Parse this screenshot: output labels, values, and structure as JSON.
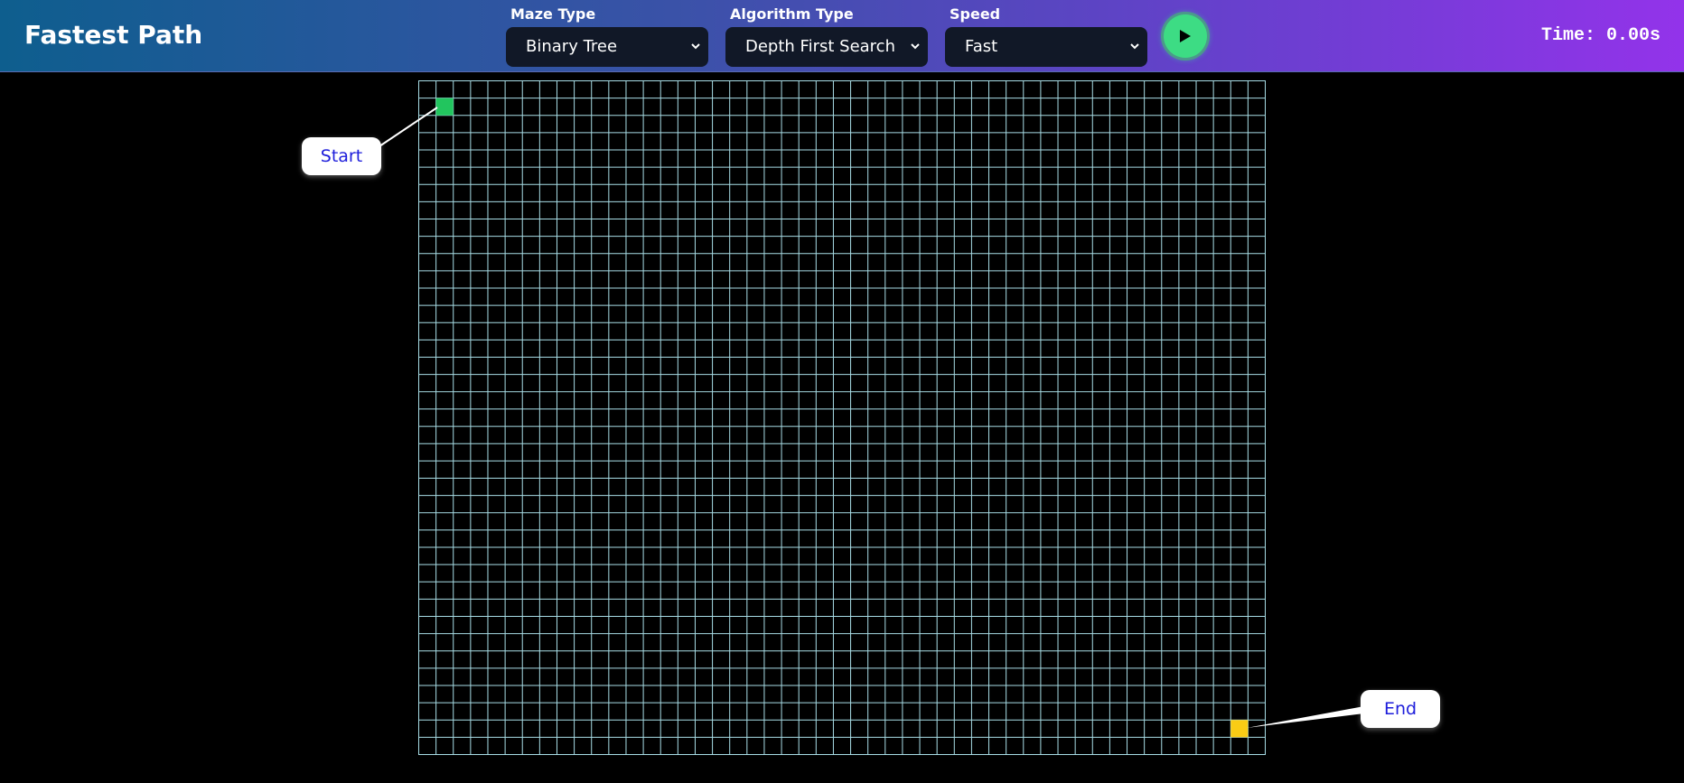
{
  "app": {
    "title": "Fastest Path"
  },
  "controls": {
    "maze_type": {
      "label": "Maze Type",
      "value": "Binary Tree"
    },
    "algorithm_type": {
      "label": "Algorithm Type",
      "value": "Depth First Search"
    },
    "speed": {
      "label": "Speed",
      "value": "Fast"
    },
    "play_icon": "play-icon"
  },
  "timer": {
    "text": "Time: 0.00s"
  },
  "grid": {
    "rows": 39,
    "cols": 49,
    "line_color": "#a8dde6",
    "start_cell": {
      "row": 1,
      "col": 1,
      "color": "#22c55e"
    },
    "end_cell": {
      "row": 37,
      "col": 47,
      "color": "#facc15"
    }
  },
  "callouts": {
    "start_label": "Start",
    "end_label": "End"
  },
  "colors": {
    "header_gradient_start": "#0e5e8e",
    "header_gradient_end": "#9333ea",
    "select_bg": "#111827",
    "play_button": "#3ddc84",
    "callout_text": "#1d1ddb"
  }
}
